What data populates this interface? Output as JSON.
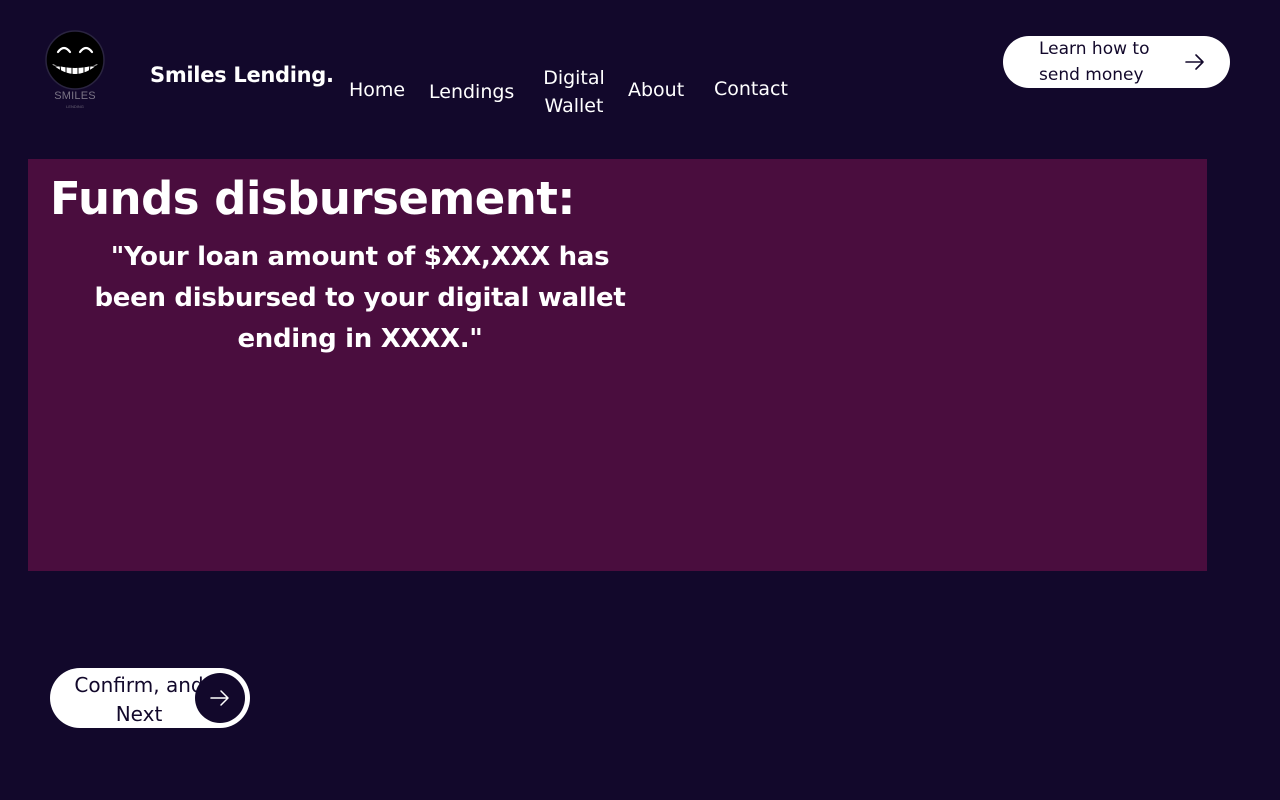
{
  "header": {
    "logo": {
      "icon": "grinning-face-icon",
      "text": "SMILES",
      "subtext": "LENDING"
    },
    "brand_name": "Smiles Lending.",
    "nav": {
      "home": "Home",
      "lendings": "Lendings",
      "digital_wallet": "Digital Wallet",
      "about": "About",
      "contact": "Contact"
    },
    "learn_button": {
      "label": "Learn how to send money",
      "icon": "arrow-right-icon"
    }
  },
  "panel": {
    "heading": "Funds disbursement:",
    "message": "\"Your loan amount of $XX,XXX has been disbursed to your digital wallet ending in XXXX.\""
  },
  "confirm_button": {
    "label": "Confirm, and Next",
    "icon": "arrow-right-icon"
  },
  "colors": {
    "background": "#12082b",
    "panel": "#4a0d3e",
    "button": "#ffffff",
    "text": "#ffffff"
  }
}
